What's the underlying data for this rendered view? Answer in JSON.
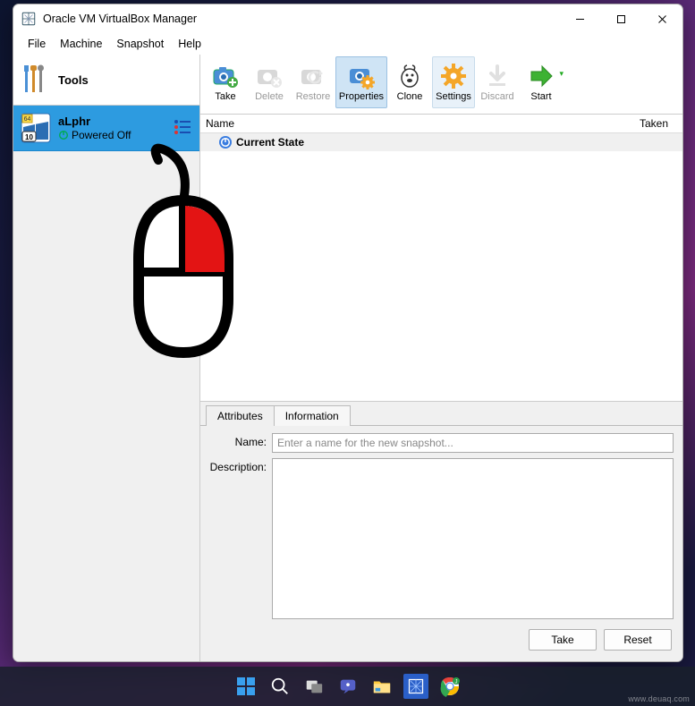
{
  "titlebar": {
    "title": "Oracle VM VirtualBox Manager"
  },
  "menu": {
    "file": "File",
    "machine": "Machine",
    "snapshot": "Snapshot",
    "help": "Help"
  },
  "tools_label": "Tools",
  "vm": {
    "name": "aLphr",
    "state": "Powered Off"
  },
  "toolbar": {
    "take": "Take",
    "delete": "Delete",
    "restore": "Restore",
    "properties": "Properties",
    "clone": "Clone",
    "settings": "Settings",
    "discard": "Discard",
    "start": "Start"
  },
  "snapshots": {
    "col_name": "Name",
    "col_taken": "Taken",
    "current": "Current State"
  },
  "attrs": {
    "tab_attributes": "Attributes",
    "tab_information": "Information",
    "name_label": "Name:",
    "name_placeholder": "Enter a name for the new snapshot...",
    "desc_label": "Description:",
    "btn_take": "Take",
    "btn_reset": "Reset"
  },
  "watermark": "www.deuaq.com"
}
